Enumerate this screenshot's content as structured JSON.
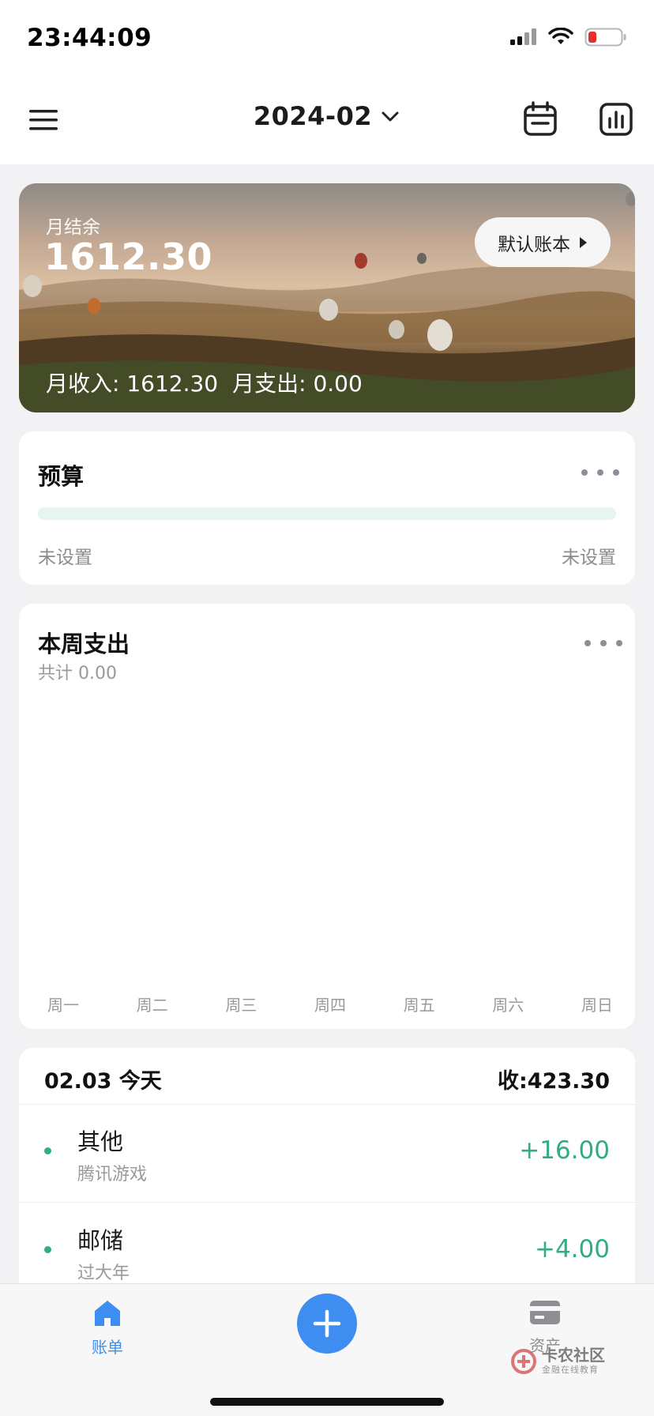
{
  "status_bar": {
    "time": "23:44:09",
    "icons": [
      "signal-icon",
      "wifi-icon",
      "battery-low-icon"
    ]
  },
  "header": {
    "month": "2024-02",
    "icons": {
      "menu": "menu-icon",
      "calendar": "calendar-icon",
      "stats": "bar-chart-icon"
    }
  },
  "hero": {
    "balance_label": "月结余",
    "balance_value": "1612.30",
    "ledger_button": "默认账本",
    "income_text": "月收入: 1612.30",
    "expense_text": "月支出: 0.00"
  },
  "budget": {
    "title": "预算",
    "left_text": "未设置",
    "right_text": "未设置",
    "progress": 0
  },
  "week": {
    "title": "本周支出",
    "total": "共计 0.00",
    "days": [
      "周一",
      "周二",
      "周三",
      "周四",
      "周五",
      "周六",
      "周日"
    ]
  },
  "transactions": {
    "date": "02.03 今天",
    "income": "收:423.30",
    "items": [
      {
        "category": "其他",
        "note": "腾讯游戏",
        "amount": "+16.00"
      },
      {
        "category": "邮储",
        "note": "过大年",
        "amount": "+4.00"
      }
    ]
  },
  "tabbar": {
    "bills_label": "账单",
    "assets_label": "资产",
    "watermark_title": "卡农社区",
    "watermark_sub": "金融在线教育"
  },
  "colors": {
    "accent": "#3d8ef0",
    "income_green": "#2fae7f",
    "budget_track": "#e6f5ef"
  }
}
